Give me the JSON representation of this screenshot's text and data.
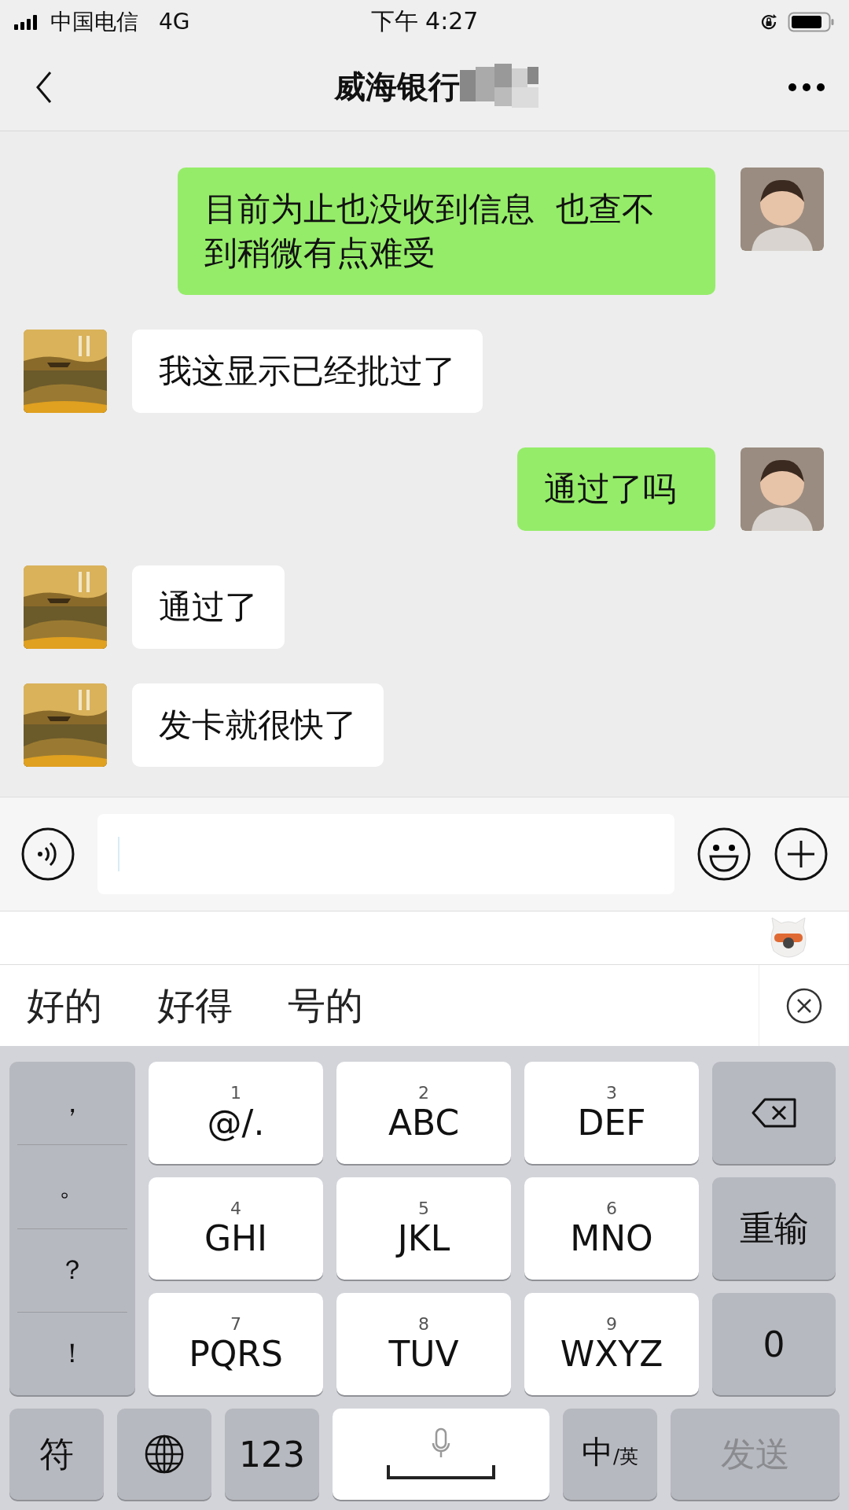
{
  "status_bar": {
    "carrier": "中国电信",
    "network": "4G",
    "time": "下午 4:27"
  },
  "nav": {
    "title": "威海银行"
  },
  "messages": [
    {
      "kind": "outgoing",
      "text": "目前为止也没收到信息  也查不到稍微有点难受"
    },
    {
      "kind": "incoming",
      "text": "我这显示已经批过了"
    },
    {
      "kind": "outgoing",
      "text": "通过了吗"
    },
    {
      "kind": "incoming",
      "text": "通过了"
    },
    {
      "kind": "incoming",
      "text": "发卡就很快了"
    }
  ],
  "candidates": [
    "好的",
    "好得",
    "号的"
  ],
  "keyboard": {
    "punctuation": [
      "，",
      "。",
      "？",
      "！"
    ],
    "keys": [
      {
        "digit": "1",
        "letters": "@/."
      },
      {
        "digit": "2",
        "letters": "ABC"
      },
      {
        "digit": "3",
        "letters": "DEF"
      },
      {
        "digit": "4",
        "letters": "GHI"
      },
      {
        "digit": "5",
        "letters": "JKL"
      },
      {
        "digit": "6",
        "letters": "MNO"
      },
      {
        "digit": "7",
        "letters": "PQRS"
      },
      {
        "digit": "8",
        "letters": "TUV"
      },
      {
        "digit": "9",
        "letters": "WXYZ"
      }
    ],
    "reset_key": "重输",
    "zero_key": "0",
    "symbol_key": "符",
    "number_key": "123",
    "lang_key": {
      "main": "中",
      "sub": "/英"
    },
    "send_key": {
      "label": "发送",
      "disabled": true
    }
  }
}
